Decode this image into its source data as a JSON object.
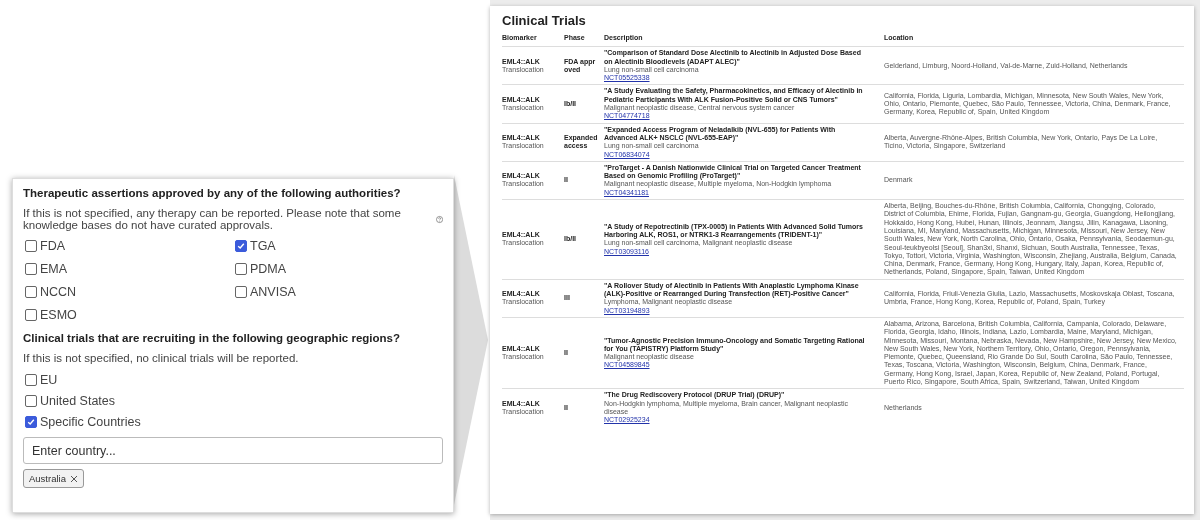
{
  "settings_panel": {
    "approvals": {
      "question": "Therapeutic assertions approved by any of the following authorities?",
      "note": "If this is not specified, any therapy can be reported. Please note that some knowledge bases do not have curated approvals.",
      "authorities": [
        {
          "label": "FDA",
          "checked": false
        },
        {
          "label": "TGA",
          "checked": true
        },
        {
          "label": "EMA",
          "checked": false
        },
        {
          "label": "PDMA",
          "checked": false
        },
        {
          "label": "NCCN",
          "checked": false
        },
        {
          "label": "ANVISA",
          "checked": false
        },
        {
          "label": "ESMO",
          "checked": false
        }
      ]
    },
    "trials": {
      "question": "Clinical trials that are recruiting in the following geographic regions?",
      "note": "If this is not specified, no clinical trials will be reported.",
      "regions": [
        {
          "label": "EU",
          "checked": false
        },
        {
          "label": "United States",
          "checked": false
        },
        {
          "label": "Specific Countries",
          "checked": true
        }
      ],
      "country_field": {
        "placeholder": "Enter country..."
      },
      "chips": [
        {
          "label": "Australia"
        }
      ]
    }
  },
  "report": {
    "title": "Clinical Trials",
    "columns": [
      "Biomarker",
      "Phase",
      "Description",
      "Location"
    ],
    "rows": [
      {
        "biomarker": "EML4::ALK",
        "biomarker_type": "Translocation",
        "phase": "FDA approved",
        "title": "\"Comparison of Standard Dose Alectinib to Alectinib in Adjusted Dose Based on Alectinib Bloodlevels (ADAPT ALEC)\"",
        "conditions": "Lung non-small cell carcinoma",
        "nct": "NCT05525338",
        "location": "Gelderland, Limburg, Noord-Holland, Val-de-Marne, Zuid-Holland, Netherlands"
      },
      {
        "biomarker": "EML4::ALK",
        "biomarker_type": "Translocation",
        "phase": "Ib/II",
        "title": "\"A Study Evaluating the Safety, Pharmacokinetics, and Efficacy of Alectinib in Pediatric Participants With ALK Fusion-Positive Solid or CNS Tumors\"",
        "conditions": "Malignant neoplastic disease, Central nervous system cancer",
        "nct": "NCT04774718",
        "location": "California, Florida, Liguria, Lombardia, Michigan, Minnesota, New South Wales, New York, Ohio, Ontario, Piemonte, Quebec, São Paulo, Tennessee, Victoria, China, Denmark, France, Germany, Korea, Republic of, Spain, United Kingdom"
      },
      {
        "biomarker": "EML4::ALK",
        "biomarker_type": "Translocation",
        "phase": "Expanded access",
        "title": "\"Expanded Access Program of Neladalkib (NVL-655) for Patients With Advanced ALK+ NSCLC (NVL-655-EAP)\"",
        "conditions": "Lung non-small cell carcinoma",
        "nct": "NCT06834074",
        "location": "Alberta, Auvergne-Rhône-Alpes, British Columbia, New York, Ontario, Pays De La Loire, Ticino, Victoria, Singapore, Switzerland"
      },
      {
        "biomarker": "EML4::ALK",
        "biomarker_type": "Translocation",
        "phase": "II",
        "title": "\"ProTarget - A Danish Nationwide Clinical Trial on Targeted Cancer Treatment Based on Genomic Profiling (ProTarget)\"",
        "conditions": "Malignant neoplastic disease, Multiple myeloma, Non-Hodgkin lymphoma",
        "nct": "NCT04341181",
        "location": "Denmark"
      },
      {
        "biomarker": "EML4::ALK",
        "biomarker_type": "Translocation",
        "phase": "Ib/II",
        "title": "\"A Study of Repotrectinib (TPX-0005) in Patients With Advanced Solid Tumors Harboring ALK, ROS1, or NTRK1-3 Rearrangements (TRIDENT-1)\"",
        "conditions": "Lung non-small cell carcinoma, Malignant neoplastic disease",
        "nct": "NCT03093116",
        "location": "Alberta, Beijing, Bouches-du-Rhône, British Columbia, California, Chongqing, Colorado, District of Columbia, Ehime, Florida, Fujian, Gangnam-gu, Georgia, Guangdong, Heilongjiang, Hokkaido, Hong Kong, Hubei, Hunan, Illinois, Jeonnam, Jiangsu, Jilin, Kanagawa, Liaoning, Louisiana, MI, Maryland, Massachusetts, Michigan, Minnesota, Missouri, New Jersey, New South Wales, New York, North Carolina, Ohio, Ontario, Osaka, Pennsylvania, Seodaemun-gu, Seoul-teukbyeolsi [Seoul], Shan3xi, Shanxi, Sichuan, South Australia, Tennessee, Texas, Tokyo, Tottori, Victoria, Virginia, Washington, Wisconsin, Zhejiang, Australia, Belgium, Canada, China, Denmark, France, Germany, Hong Kong, Hungary, Italy, Japan, Korea, Republic of, Netherlands, Poland, Singapore, Spain, Taiwan, United Kingdom"
      },
      {
        "biomarker": "EML4::ALK",
        "biomarker_type": "Translocation",
        "phase": "III",
        "title": "\"A Rollover Study of Alectinib in Patients With Anaplastic Lymphoma Kinase (ALK)-Positive or Rearranged During Transfection (RET)-Positive Cancer\"",
        "conditions": "Lymphoma, Malignant neoplastic disease",
        "nct": "NCT03194893",
        "location": "California, Florida, Friuli-Venezia Giulia, Lazio, Massachusetts, Moskovskaja Oblast, Toscana, Umbria, France, Hong Kong, Korea, Republic of, Poland, Spain, Turkey"
      },
      {
        "biomarker": "EML4::ALK",
        "biomarker_type": "Translocation",
        "phase": "II",
        "title": "\"Tumor-Agnostic Precision Immuno-Oncology and Somatic Targeting Rational for You (TAPISTRY) Platform Study\"",
        "conditions": "Malignant neoplastic disease",
        "nct": "NCT04589845",
        "location": "Alabama, Arizona, Barcelona, British Columbia, California, Campania, Colorado, Delaware, Florida, Georgia, Idaho, Illinois, Indiana, Lazio, Lombardia, Maine, Maryland, Michigan, Minnesota, Missouri, Montana, Nebraska, Nevada, New Hampshire, New Jersey, New Mexico, New South Wales, New York, Northern Territory, Ohio, Ontario, Oregon, Pennsylvania, Piemonte, Quebec, Queensland, Rio Grande Do Sul, South Carolina, São Paulo, Tennessee, Texas, Toscana, Victoria, Washington, Wisconsin, Belgium, China, Denmark, France, Germany, Hong Kong, Israel, Japan, Korea, Republic of, New Zealand, Poland, Portugal, Puerto Rico, Singapore, South Africa, Spain, Switzerland, Taiwan, United Kingdom"
      },
      {
        "biomarker": "EML4::ALK",
        "biomarker_type": "Translocation",
        "phase": "II",
        "title": "\"The Drug Rediscovery Protocol (DRUP Trial) (DRUP)\"",
        "conditions": "Non-Hodgkin lymphoma, Multiple myeloma, Brain cancer, Malignant neoplastic disease",
        "nct": "NCT02925234",
        "location": "Netherlands"
      }
    ]
  }
}
